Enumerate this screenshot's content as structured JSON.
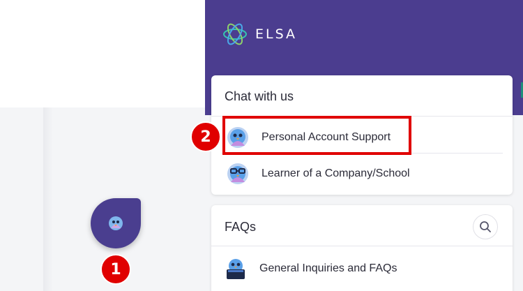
{
  "brand": {
    "name": "ELSA"
  },
  "chat_card": {
    "title": "Chat with us",
    "items": [
      {
        "label": "Personal Account Support",
        "icon": "penguin-avatar-icon"
      },
      {
        "label": "Learner of a Company/School",
        "icon": "penguin-glasses-avatar-icon"
      }
    ]
  },
  "faq_card": {
    "title": "FAQs",
    "items": [
      {
        "label": "General Inquiries and FAQs",
        "icon": "penguin-book-icon"
      }
    ]
  },
  "callouts": {
    "first": "1",
    "second": "2"
  },
  "colors": {
    "brand_purple": "#4b3d8f",
    "callout_red": "#e00000",
    "card_bg": "#ffffff",
    "page_bg": "#f4f5f7"
  }
}
